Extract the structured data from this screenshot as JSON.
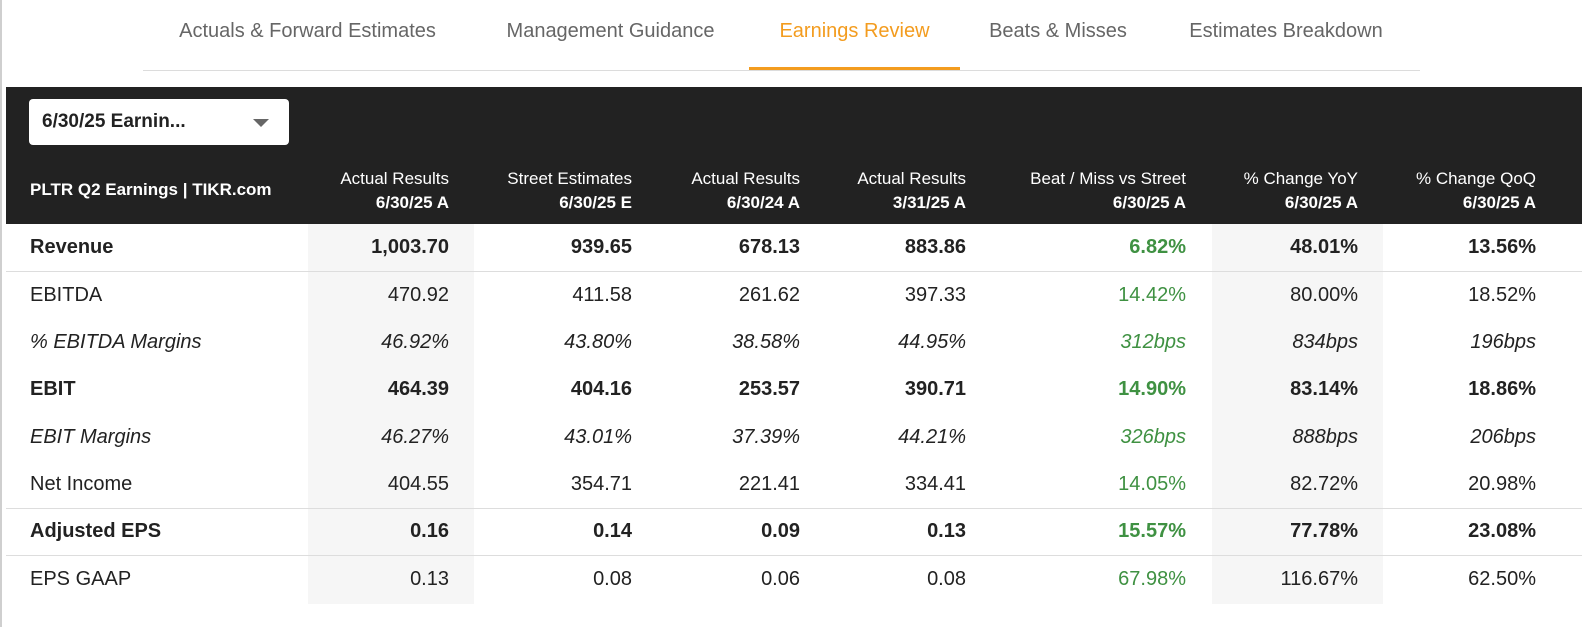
{
  "tabs": [
    {
      "label": "Actuals & Forward Estimates"
    },
    {
      "label": "Management Guidance"
    },
    {
      "label": "Earnings Review"
    },
    {
      "label": "Beats & Misses"
    },
    {
      "label": "Estimates Breakdown"
    }
  ],
  "active_tab": "Earnings Review",
  "colors": {
    "accent": "#f39c1f",
    "header_bg": "#222222",
    "positive": "#3f9142"
  },
  "dropdown": {
    "value": "6/30/25 Earnin..."
  },
  "table": {
    "title": "PLTR Q2 Earnings | TIKR.com",
    "columns": [
      {
        "line1": "Actual Results",
        "line2": "6/30/25 A"
      },
      {
        "line1": "Street Estimates",
        "line2": "6/30/25 E"
      },
      {
        "line1": "Actual Results",
        "line2": "6/30/24 A"
      },
      {
        "line1": "Actual Results",
        "line2": "3/31/25 A"
      },
      {
        "line1": "Beat / Miss vs Street",
        "line2": "6/30/25 A"
      },
      {
        "line1": "% Change YoY",
        "line2": "6/30/25 A"
      },
      {
        "line1": "% Change QoQ",
        "line2": "6/30/25 A"
      }
    ],
    "rows": [
      {
        "label": "Revenue",
        "values": [
          "1,003.70",
          "939.65",
          "678.13",
          "883.86",
          "6.82%",
          "48.01%",
          "13.56%"
        ]
      },
      {
        "label": "EBITDA",
        "values": [
          "470.92",
          "411.58",
          "261.62",
          "397.33",
          "14.42%",
          "80.00%",
          "18.52%"
        ]
      },
      {
        "label": "% EBITDA Margins",
        "values": [
          "46.92%",
          "43.80%",
          "38.58%",
          "44.95%",
          "312bps",
          "834bps",
          "196bps"
        ]
      },
      {
        "label": "EBIT",
        "values": [
          "464.39",
          "404.16",
          "253.57",
          "390.71",
          "14.90%",
          "83.14%",
          "18.86%"
        ]
      },
      {
        "label": "EBIT Margins",
        "values": [
          "46.27%",
          "43.01%",
          "37.39%",
          "44.21%",
          "326bps",
          "888bps",
          "206bps"
        ]
      },
      {
        "label": "Net Income",
        "values": [
          "404.55",
          "354.71",
          "221.41",
          "334.41",
          "14.05%",
          "82.72%",
          "20.98%"
        ]
      },
      {
        "label": "Adjusted EPS",
        "values": [
          "0.16",
          "0.14",
          "0.09",
          "0.13",
          "15.57%",
          "77.78%",
          "23.08%"
        ]
      },
      {
        "label": "EPS GAAP",
        "values": [
          "0.13",
          "0.08",
          "0.06",
          "0.08",
          "67.98%",
          "116.67%",
          "62.50%"
        ]
      }
    ]
  }
}
